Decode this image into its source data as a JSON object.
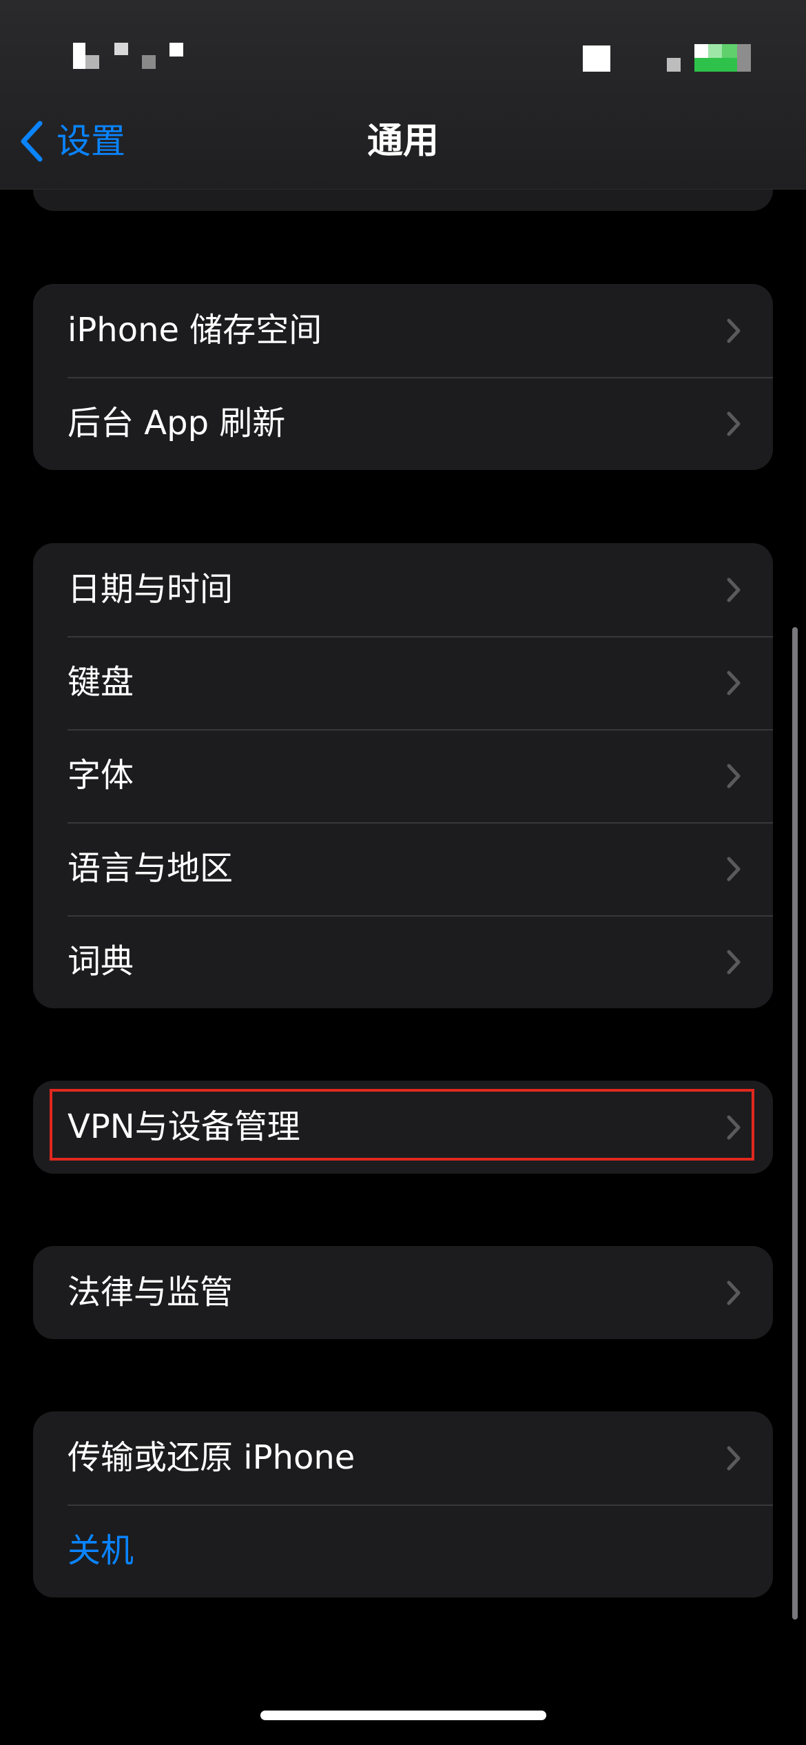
{
  "nav": {
    "back_label": "设置",
    "title": "通用"
  },
  "groups": [
    {
      "items": [
        {
          "label": "iPhone 储存空间"
        },
        {
          "label": "后台 App 刷新"
        }
      ]
    },
    {
      "items": [
        {
          "label": "日期与时间"
        },
        {
          "label": "键盘"
        },
        {
          "label": "字体"
        },
        {
          "label": "语言与地区"
        },
        {
          "label": "词典"
        }
      ]
    },
    {
      "items": [
        {
          "label": "VPN与设备管理",
          "highlighted": true
        }
      ]
    },
    {
      "items": [
        {
          "label": "法律与监管"
        }
      ]
    },
    {
      "items": [
        {
          "label": "传输或还原 iPhone"
        },
        {
          "label": "关机",
          "style": "action"
        }
      ]
    }
  ],
  "colors": {
    "accent": "#0a84ff",
    "cell_bg": "#1c1c1e",
    "background": "#000000",
    "highlight_border": "#e0281e"
  },
  "icons": {
    "back": "chevron-left-icon",
    "disclosure": "chevron-right-icon"
  }
}
